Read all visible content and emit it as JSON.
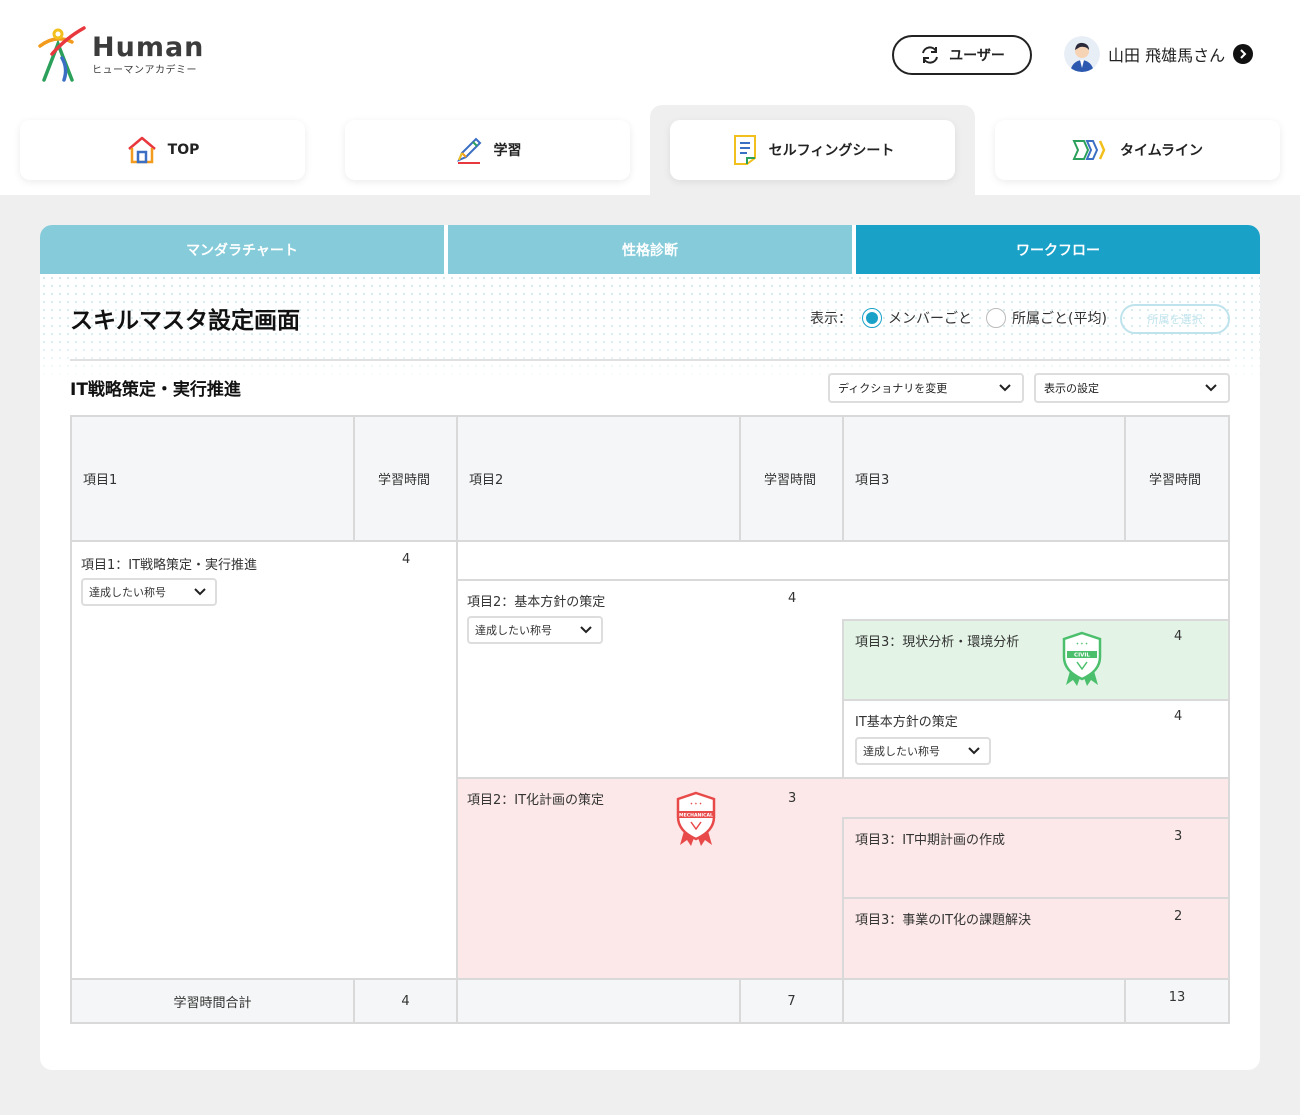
{
  "header": {
    "logo_word": "Human",
    "logo_sub": "ヒューマンアカデミー",
    "user_button_label": "ユーザー",
    "profile_name": "山田 飛雄馬さん"
  },
  "nav": {
    "tabs": [
      {
        "label": "TOP",
        "icon": "house-icon"
      },
      {
        "label": "学習",
        "icon": "pencil-icon"
      },
      {
        "label": "セルフィングシート",
        "icon": "sheet-icon",
        "active": true
      },
      {
        "label": "タイムライン",
        "icon": "timeline-arrows-icon"
      }
    ]
  },
  "subtabs": [
    {
      "label": "マンダラチャート"
    },
    {
      "label": "性格診断"
    },
    {
      "label": "ワークフロー",
      "active": true
    }
  ],
  "colors": {
    "accent": "#1aa1c8",
    "subtab_inactive": "#86cbd9",
    "green_row": "#e3f4e6",
    "red_row": "#fce8e8"
  },
  "page": {
    "title": "スキルマスタ設定画面",
    "view_label": "表示：",
    "radio_member": "メンバーごと",
    "radio_affiliation": "所属ごと(平均)",
    "select_affiliation": "所属を選択",
    "selected_view": "メンバーごと"
  },
  "section": {
    "title": "IT戦略策定・実行推進",
    "dictionary_dropdown": "ディクショナリを変更",
    "display_dropdown": "表示の設定"
  },
  "table": {
    "headers": [
      "項目1",
      "学習時間",
      "項目2",
      "学習時間",
      "項目3",
      "学習時間"
    ],
    "title_dropdown": "達成したい称号",
    "level1": {
      "name": "項目1：IT戦略策定・実行推進",
      "hours": "4"
    },
    "level2": [
      {
        "name": "項目2：基本方針の策定",
        "hours": "4"
      },
      {
        "name": "項目2：IT化計画の策定",
        "hours": "3",
        "badge": "MECHANICAL"
      }
    ],
    "level3": [
      {
        "name": "項目3：現状分析・環境分析",
        "hours": "4",
        "badge": "CIVIL"
      },
      {
        "name": "IT基本方針の策定",
        "hours": "4"
      },
      {
        "name": "項目3：IT中期計画の作成",
        "hours": "3"
      },
      {
        "name": "項目3：事業のIT化の課題解決",
        "hours": "2"
      }
    ],
    "footer": {
      "label": "学習時間合計",
      "total1": "4",
      "total2": "7",
      "total3": "13"
    }
  }
}
